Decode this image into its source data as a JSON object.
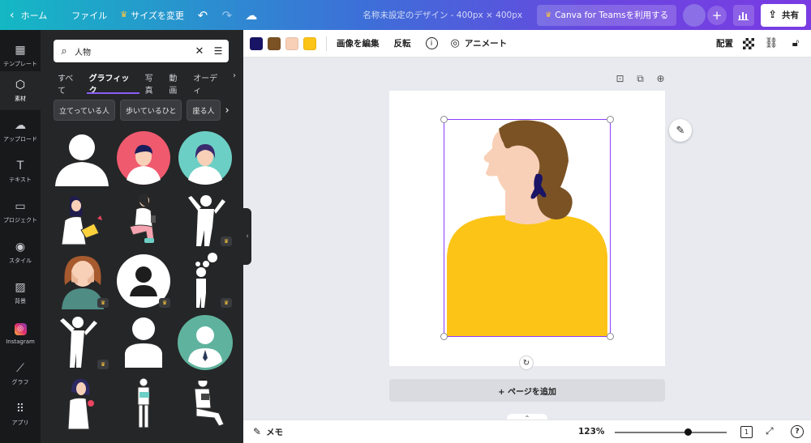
{
  "topbar": {
    "home": "ホーム",
    "file": "ファイル",
    "resize": "サイズを変更",
    "title": "名称未設定のデザイン - 400px × 400px",
    "teams": "Canva for Teamsを利用する",
    "share": "共有"
  },
  "rail": {
    "items": [
      {
        "label": "テンプレート",
        "icon": "template-icon"
      },
      {
        "label": "素材",
        "icon": "elements-icon"
      },
      {
        "label": "アップロード",
        "icon": "upload-icon"
      },
      {
        "label": "テキスト",
        "icon": "text-icon"
      },
      {
        "label": "プロジェクト",
        "icon": "folder-icon"
      },
      {
        "label": "スタイル",
        "icon": "palette-icon"
      },
      {
        "label": "背景",
        "icon": "background-icon"
      },
      {
        "label": "Instagram",
        "icon": "instagram-icon"
      },
      {
        "label": "グラフ",
        "icon": "chart-icon"
      },
      {
        "label": "アプリ",
        "icon": "apps-icon"
      }
    ]
  },
  "panel": {
    "search": {
      "value": "人物"
    },
    "tabs": [
      "すべて",
      "グラフィック",
      "写真",
      "動画",
      "オーディ"
    ],
    "chips": [
      "立てっている人",
      "歩いているひと",
      "座る人"
    ]
  },
  "context_toolbar": {
    "colors": [
      "#1a1466",
      "#7b5224",
      "#f8d0b8",
      "#fcc417"
    ],
    "edit_image": "画像を編集",
    "flip": "反転",
    "animate": "アニメート",
    "position": "配置"
  },
  "canvas": {
    "add_page": "+ ページを追加",
    "illustration": {
      "hair_color": "#7b5224",
      "skin_color": "#f8d0b8",
      "shirt_color": "#fcc417",
      "earring_color": "#1a1466"
    }
  },
  "bottombar": {
    "memo": "メモ",
    "zoom": "123%",
    "zoom_fraction": 0.63,
    "page_count": "1"
  }
}
